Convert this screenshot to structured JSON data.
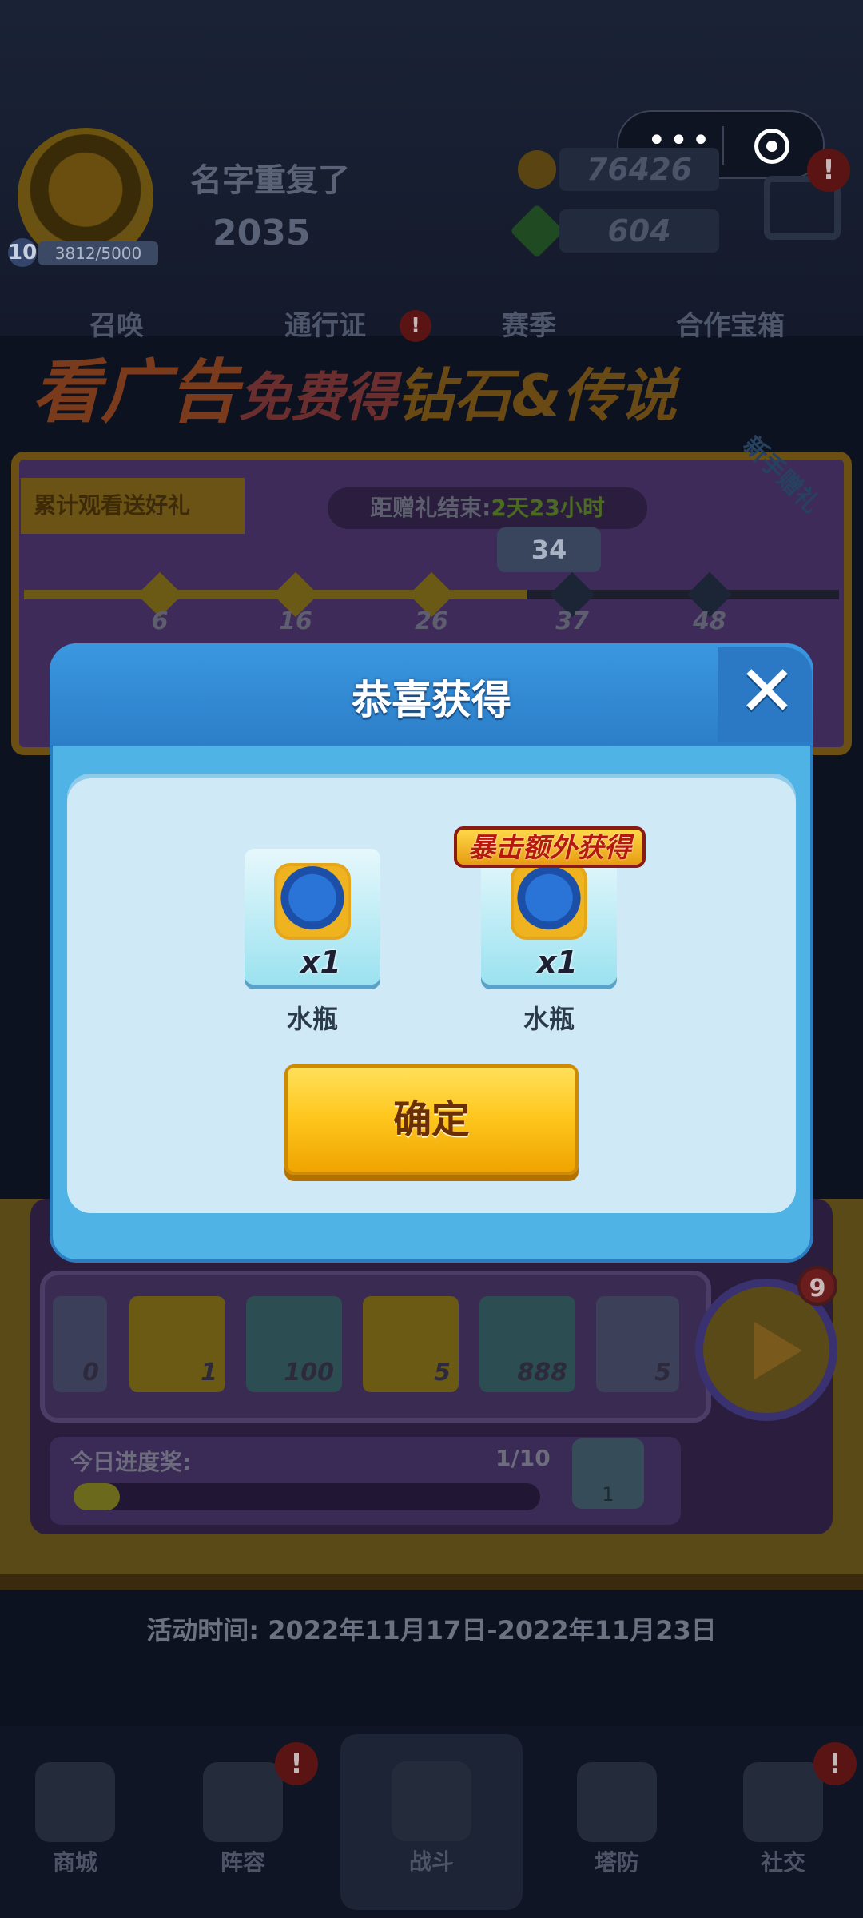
{
  "header": {
    "player_name": "名字重复了",
    "level": "10",
    "xp": "3812/5000",
    "trophies": "2035",
    "gold": "76426",
    "gems": "604",
    "capsule_dots": "•••"
  },
  "tabs": [
    "召唤",
    "通行证",
    "赛季",
    "合作宝箱"
  ],
  "event": {
    "banner_title_a": "看广告",
    "banner_title_b": "免费得",
    "banner_title_c": "钻石&传说",
    "ribbon": "累计观看送好礼",
    "countdown_label": "距赠礼结束:",
    "countdown_value": "2天23小时",
    "new_tag": "新手赠礼",
    "current_progress": "34",
    "milestones": [
      "6",
      "16",
      "26",
      "37",
      "48"
    ]
  },
  "rewards_strip": [
    {
      "qty": "0"
    },
    {
      "qty": "1"
    },
    {
      "qty": "100"
    },
    {
      "qty": "5"
    },
    {
      "qty": "888"
    },
    {
      "qty": "5"
    }
  ],
  "play_badge": "9",
  "daily": {
    "label": "今日进度奖:",
    "value": "1/10",
    "progress_fraction": 0.1,
    "chest_qty": "1"
  },
  "activity_time": "活动时间: 2022年11月17日-2022年11月23日",
  "bottom_nav": [
    "商城",
    "阵容",
    "战斗",
    "塔防",
    "社交"
  ],
  "modal": {
    "title": "恭喜获得",
    "crit_label": "暴击额外获得",
    "items": [
      {
        "qty": "x1",
        "name": "水瓶"
      },
      {
        "qty": "x1",
        "name": "水瓶"
      }
    ],
    "confirm_label": "确定"
  },
  "colors": {
    "modal_blue": "#4fb3e6",
    "confirm_yellow": "#ffc820",
    "crit_red": "#b61a0e"
  }
}
